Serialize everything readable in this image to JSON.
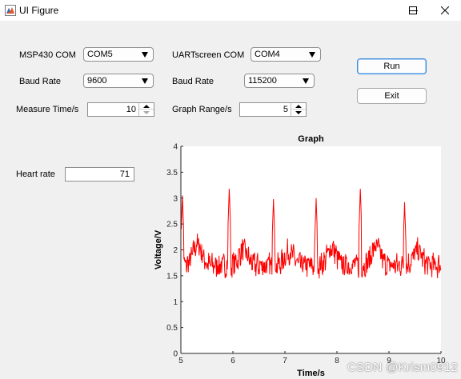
{
  "window": {
    "title": "UI Figure"
  },
  "controls": {
    "msp_com": {
      "label": "MSP430 COM",
      "value": "COM5"
    },
    "uart_com": {
      "label": "UARTscreen COM",
      "value": "COM4"
    },
    "baud_left": {
      "label": "Baud Rate",
      "value": "9600"
    },
    "baud_right": {
      "label": "Baud Rate",
      "value": "115200"
    },
    "measure_time": {
      "label": "Measure Time/s",
      "value": "10"
    },
    "graph_range": {
      "label": "Graph Range/s",
      "value": "5"
    },
    "heart_rate": {
      "label": "Heart rate",
      "value": "71"
    },
    "run_label": "Run",
    "exit_label": "Exit"
  },
  "chart_data": {
    "type": "line",
    "title": "Graph",
    "xlabel": "Time/s",
    "ylabel": "Voltage/V",
    "xlim": [
      5,
      10
    ],
    "ylim": [
      0,
      4
    ],
    "xticks": [
      "5",
      "6",
      "7",
      "8",
      "9",
      "10"
    ],
    "yticks": [
      "0",
      "0.5",
      "1",
      "1.5",
      "2",
      "2.5",
      "3",
      "3.5",
      "4"
    ],
    "grid": false,
    "series": [
      {
        "color": "#ff0000",
        "baseline": 1.7,
        "noise_amplitude": 0.22,
        "points_per_second": 120,
        "peaks": [
          {
            "x": 5.03,
            "y": 3.05
          },
          {
            "x": 5.93,
            "y": 3.18
          },
          {
            "x": 6.78,
            "y": 2.98
          },
          {
            "x": 7.6,
            "y": 3.0
          },
          {
            "x": 8.45,
            "y": 3.18
          },
          {
            "x": 9.3,
            "y": 2.92
          }
        ],
        "bumps": [
          {
            "x": 5.32,
            "y": 2.28
          },
          {
            "x": 6.2,
            "y": 2.12
          },
          {
            "x": 7.08,
            "y": 2.08
          },
          {
            "x": 7.9,
            "y": 2.18
          },
          {
            "x": 8.75,
            "y": 2.22
          },
          {
            "x": 9.55,
            "y": 2.1
          }
        ]
      }
    ]
  },
  "watermark": "CSDN @Krism0912"
}
